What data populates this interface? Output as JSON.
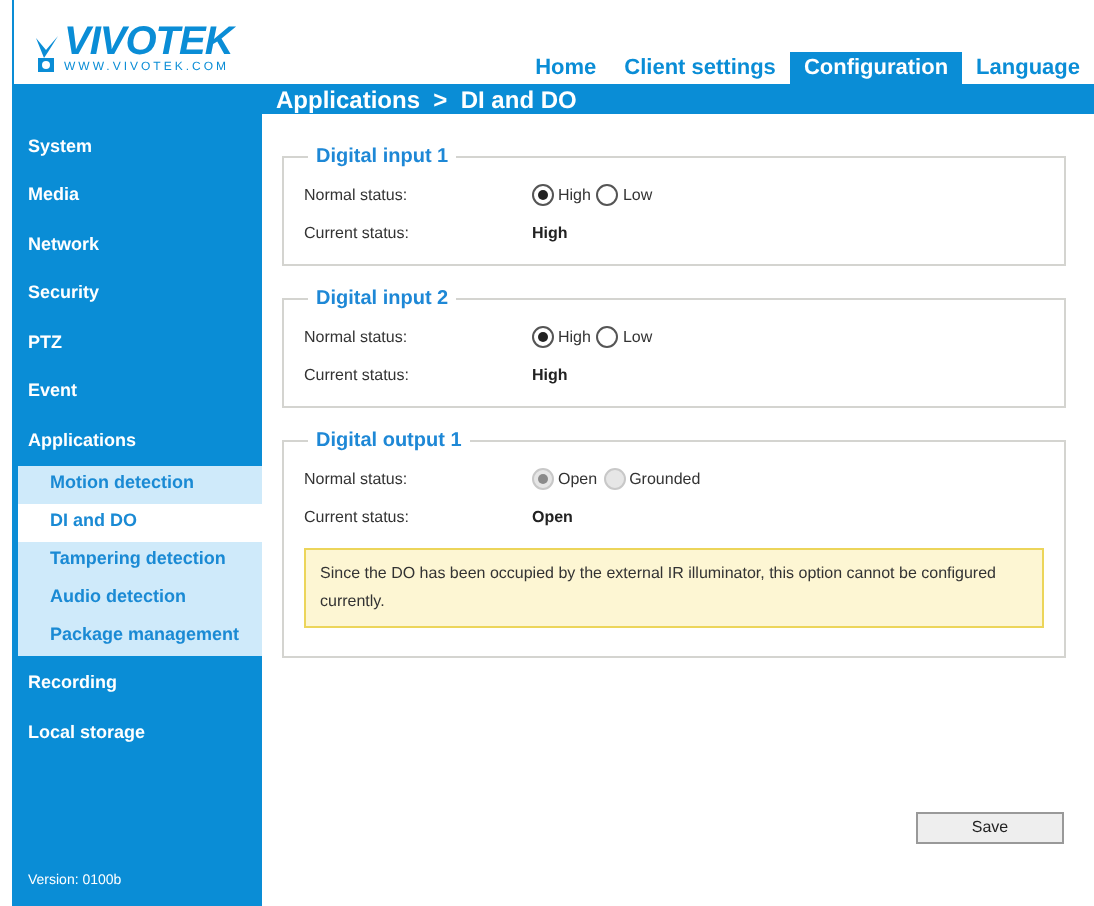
{
  "logo": {
    "name": "VIVOTEK",
    "url": "WWW.VIVOTEK.COM"
  },
  "nav_tabs": [
    {
      "label": "Home",
      "selected": false
    },
    {
      "label": "Client settings",
      "selected": false
    },
    {
      "label": "Configuration",
      "selected": true
    },
    {
      "label": "Language",
      "selected": false
    }
  ],
  "breadcrumb": "Applications  >  DI and DO",
  "sidebar": {
    "items": [
      {
        "label": "System",
        "selected": false
      },
      {
        "label": "Media",
        "selected": false
      },
      {
        "label": "Network",
        "selected": false
      },
      {
        "label": "Security",
        "selected": false
      },
      {
        "label": "PTZ",
        "selected": false
      },
      {
        "label": "Event",
        "selected": false
      },
      {
        "label": "Applications",
        "selected": false,
        "expanded": true,
        "children": [
          {
            "label": "Motion detection",
            "selected": false
          },
          {
            "label": "DI and DO",
            "selected": true
          },
          {
            "label": "Tampering detection",
            "selected": false
          },
          {
            "label": "Audio detection",
            "selected": false
          },
          {
            "label": "Package management",
            "selected": false
          }
        ]
      },
      {
        "label": "Recording",
        "selected": false
      },
      {
        "label": "Local storage",
        "selected": false
      }
    ],
    "version": "Version: 0100b"
  },
  "sections": [
    {
      "title": "Digital input 1",
      "rows": [
        {
          "kind": "radio",
          "label": "Normal status:",
          "disabled": false,
          "options": [
            {
              "label": "High",
              "selected": true
            },
            {
              "label": "Low",
              "selected": false
            }
          ]
        },
        {
          "kind": "value",
          "label": "Current status:",
          "value": "High"
        }
      ]
    },
    {
      "title": "Digital input 2",
      "rows": [
        {
          "kind": "radio",
          "label": "Normal status:",
          "disabled": false,
          "options": [
            {
              "label": "High",
              "selected": true
            },
            {
              "label": "Low",
              "selected": false
            }
          ]
        },
        {
          "kind": "value",
          "label": "Current status:",
          "value": "High"
        }
      ]
    },
    {
      "title": "Digital output 1",
      "rows": [
        {
          "kind": "radio",
          "label": "Normal status:",
          "disabled": true,
          "options": [
            {
              "label": "Open",
              "selected": true
            },
            {
              "label": "Grounded",
              "selected": false
            }
          ]
        },
        {
          "kind": "value",
          "label": "Current status:",
          "value": "Open"
        }
      ],
      "notice": "Since the DO has been occupied by the external IR illuminator, this option cannot be configured currently."
    }
  ],
  "save_button": "Save"
}
